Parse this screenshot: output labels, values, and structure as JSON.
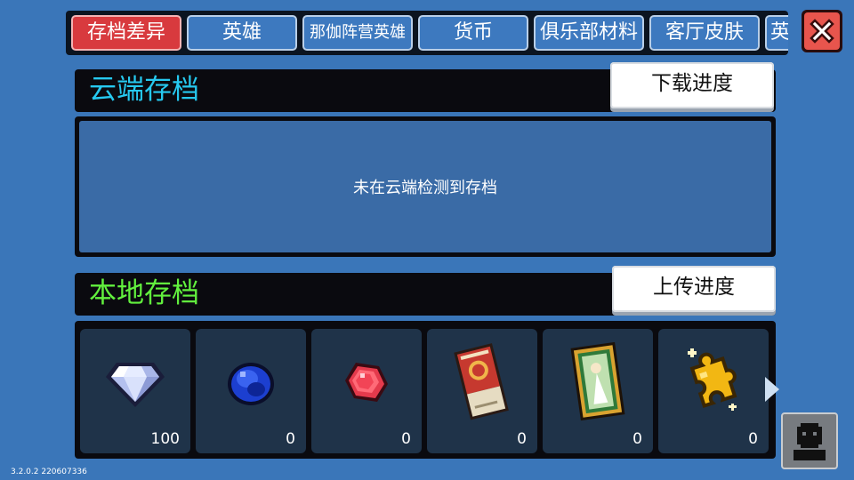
{
  "tabs": [
    {
      "label": "存档差异",
      "active": true
    },
    {
      "label": "英雄",
      "active": false
    },
    {
      "label": "那伽阵营英雄",
      "active": false
    },
    {
      "label": "货币",
      "active": false
    },
    {
      "label": "俱乐部材料",
      "active": false
    },
    {
      "label": "客厅皮肤",
      "active": false
    },
    {
      "label": "英",
      "active": false
    }
  ],
  "cloud": {
    "title": "云端存档",
    "title_color": "#26c9f0",
    "download_label": "下载进度",
    "empty_message": "未在云端检测到存档"
  },
  "local": {
    "title": "本地存档",
    "title_color": "#62f03e",
    "upload_label": "上传进度",
    "items": [
      {
        "icon": "diamond-gem-icon",
        "count": "100"
      },
      {
        "icon": "blue-sapphire-icon",
        "count": "0"
      },
      {
        "icon": "red-ruby-icon",
        "count": "0"
      },
      {
        "icon": "ticket-icon",
        "count": "0"
      },
      {
        "icon": "tarot-card-icon",
        "count": "0"
      },
      {
        "icon": "gold-puzzle-piece-icon",
        "count": "0"
      }
    ]
  },
  "version": "3.2.0.2 220607336"
}
